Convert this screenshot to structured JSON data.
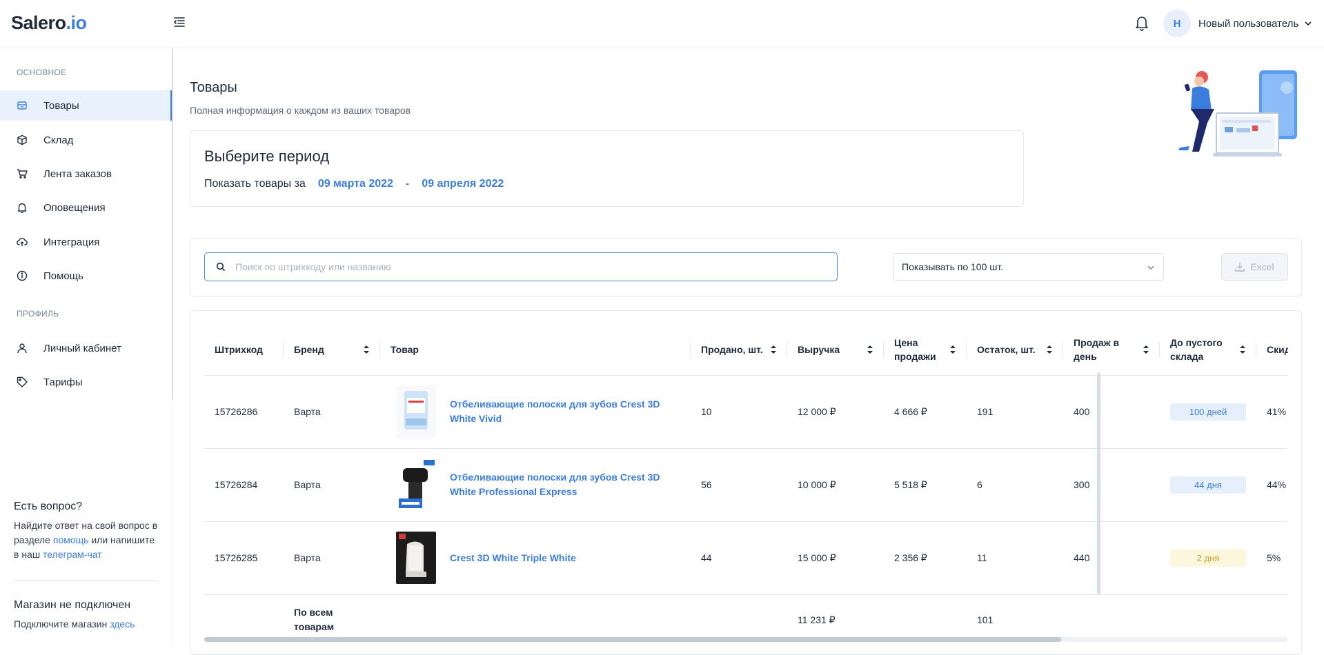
{
  "app": {
    "logo_main": "Salero",
    "logo_suffix": ".io"
  },
  "header": {
    "avatar_initial": "Н",
    "user_name": "Новый пользователь"
  },
  "sidebar": {
    "section_main": "ОСНОВНОЕ",
    "section_profile": "ПРОФИЛЬ",
    "items": [
      {
        "label": "Товары",
        "icon": "box-icon",
        "active": true
      },
      {
        "label": "Склад",
        "icon": "cube-icon"
      },
      {
        "label": "Лента заказов",
        "icon": "cart-icon"
      },
      {
        "label": "Оповещения",
        "icon": "bell-icon"
      },
      {
        "label": "Интеграция",
        "icon": "cloud-upload-icon"
      },
      {
        "label": "Помощь",
        "icon": "info-icon"
      }
    ],
    "profile_items": [
      {
        "label": "Личный кабинет",
        "icon": "user-icon"
      },
      {
        "label": "Тарифы",
        "icon": "tag-icon"
      }
    ],
    "help": {
      "title": "Есть вопрос?",
      "text_1": "Найдите ответ на свой вопрос в разделе ",
      "link_help": "помощь",
      "text_2": " или напишите в наш ",
      "link_telegram": "телеграм-чат"
    },
    "store": {
      "title": "Магазин не подключен",
      "text": "Подключите магазин ",
      "link": "здесь"
    }
  },
  "page": {
    "title": "Товары",
    "subtitle": "Полная информация о каждом из ваших товаров"
  },
  "period": {
    "title": "Выберите период",
    "label": "Показать товары за",
    "date_from": "09 марта 2022",
    "separator": "-",
    "date_to": "09 апреля 2022"
  },
  "filters": {
    "search_placeholder": "Поиск по штрихкоду или названию",
    "page_size": "Показывать по 100 шт.",
    "excel_label": "Excel"
  },
  "table": {
    "columns": [
      "Штрихкод",
      "Бренд",
      "Товар",
      "Продано, шт.",
      "Выручка",
      "Цена продажи",
      "Остаток, шт.",
      "Продаж в день",
      "До пустого склада",
      "Скидка"
    ],
    "rows": [
      {
        "barcode": "15726286",
        "brand": "Варта",
        "product": "Отбеливающие полоски для зубов Crest 3D White Vivid",
        "sold": "10",
        "revenue": "12 000 ₽",
        "price": "4 666 ₽",
        "stock": "191",
        "per_day": "400",
        "to_empty": "100 дней",
        "to_empty_status": "blue",
        "discount": "41%"
      },
      {
        "barcode": "15726284",
        "brand": "Варта",
        "product": "Отбеливающие полоски для зубов Crest 3D White Professional Express",
        "sold": "56",
        "revenue": "10 000 ₽",
        "price": "5 518 ₽",
        "stock": "6",
        "per_day": "300",
        "to_empty": "44 дня",
        "to_empty_status": "blue",
        "discount": "44%"
      },
      {
        "barcode": "15726285",
        "brand": "Варта",
        "product": "Crest 3D White Triple White",
        "sold": "44",
        "revenue": "15 000 ₽",
        "price": "2 356 ₽",
        "stock": "11",
        "per_day": "440",
        "to_empty": "2 дня",
        "to_empty_status": "yellow",
        "discount": "5%"
      }
    ],
    "total": {
      "label": "По всем товарам",
      "revenue": "11 231 ₽",
      "stock": "101"
    }
  },
  "colors": {
    "accent": "#3b7ddd",
    "badge_blue_bg": "#e6effc",
    "badge_yellow_bg": "#fcf6dc"
  }
}
